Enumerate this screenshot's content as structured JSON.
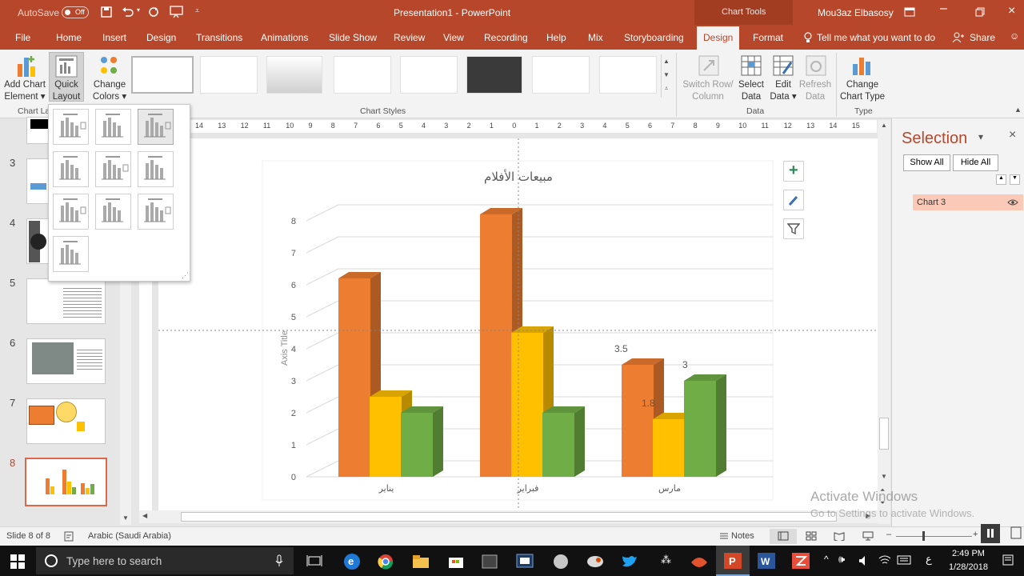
{
  "titlebar": {
    "autosave_label": "AutoSave",
    "autosave_state": "Off",
    "doc_title": "Presentation1  -  PowerPoint",
    "context_label": "Chart Tools",
    "user": "Mou3az Elbasosy"
  },
  "tabs": [
    "File",
    "Home",
    "Insert",
    "Design",
    "Transitions",
    "Animations",
    "Slide Show",
    "Review",
    "View",
    "Recording",
    "Help",
    "Mix",
    "Storyboarding",
    "Design",
    "Format"
  ],
  "active_tab_index": 13,
  "tell_me": "Tell me what you want to do",
  "share": "Share",
  "ribbon": {
    "add_chart_element": [
      "Add Chart",
      "Element"
    ],
    "quick_layout": [
      "Quick",
      "Layout"
    ],
    "change_colors": [
      "Change",
      "Colors"
    ],
    "chart_layouts_group": "Chart La",
    "chart_styles_group": "Chart Styles",
    "switch_row_col": [
      "Switch Row/",
      "Column"
    ],
    "select_data": [
      "Select",
      "Data"
    ],
    "edit_data": [
      "Edit",
      "Data"
    ],
    "refresh_data": [
      "Refresh",
      "Data"
    ],
    "data_group": "Data",
    "change_chart_type": [
      "Change",
      "Chart Type"
    ],
    "type_group": "Type"
  },
  "slides": [
    {
      "number": "3"
    },
    {
      "number": "4"
    },
    {
      "number": "5"
    },
    {
      "number": "6"
    },
    {
      "number": "7"
    },
    {
      "number": "8"
    }
  ],
  "selected_slide": "8",
  "ruler_numbers": [
    "14",
    "13",
    "12",
    "11",
    "10",
    "9",
    "8",
    "7",
    "6",
    "5",
    "4",
    "3",
    "2",
    "1",
    "0",
    "1",
    "2",
    "3",
    "4",
    "5",
    "6",
    "7",
    "8",
    "9",
    "10",
    "11",
    "12",
    "13",
    "14",
    "15"
  ],
  "selection_pane": {
    "title": "Selection",
    "show_all": "Show All",
    "hide_all": "Hide All",
    "item": "Chart 3"
  },
  "chart_data": {
    "type": "bar",
    "title": "مبيعات الأفلام",
    "ylabel": "Axis Title",
    "xlabel": "",
    "categories": [
      "يناير",
      "فبراير",
      "مارس"
    ],
    "series": [
      {
        "values": [
          6.2,
          8.2,
          3.5
        ],
        "color": "#ed7d31"
      },
      {
        "values": [
          2.5,
          4.5,
          1.8
        ],
        "color": "#ffc000"
      },
      {
        "values": [
          2.0,
          2.0,
          3.0
        ],
        "color": "#70ad47"
      }
    ],
    "yticks": [
      "0",
      "1",
      "2",
      "3",
      "4",
      "5",
      "6",
      "7",
      "8"
    ],
    "ylim": [
      0,
      8
    ],
    "data_labels": [
      "3.5",
      "1.8",
      "3"
    ],
    "grid": true
  },
  "status": {
    "slide_info": "Slide 8 of 8",
    "language": "Arabic (Saudi Arabia)",
    "notes": "Notes"
  },
  "watermark": {
    "line1": "Activate Windows",
    "line2": "Go to Settings to activate Windows."
  },
  "taskbar": {
    "search_placeholder": "Type here to search",
    "time": "2:49 PM",
    "date": "1/28/2018",
    "lang": "ع"
  },
  "colors": {
    "accent": "#b7472a",
    "orange": "#ed7d31",
    "yellow": "#ffc000",
    "green": "#70ad47"
  }
}
